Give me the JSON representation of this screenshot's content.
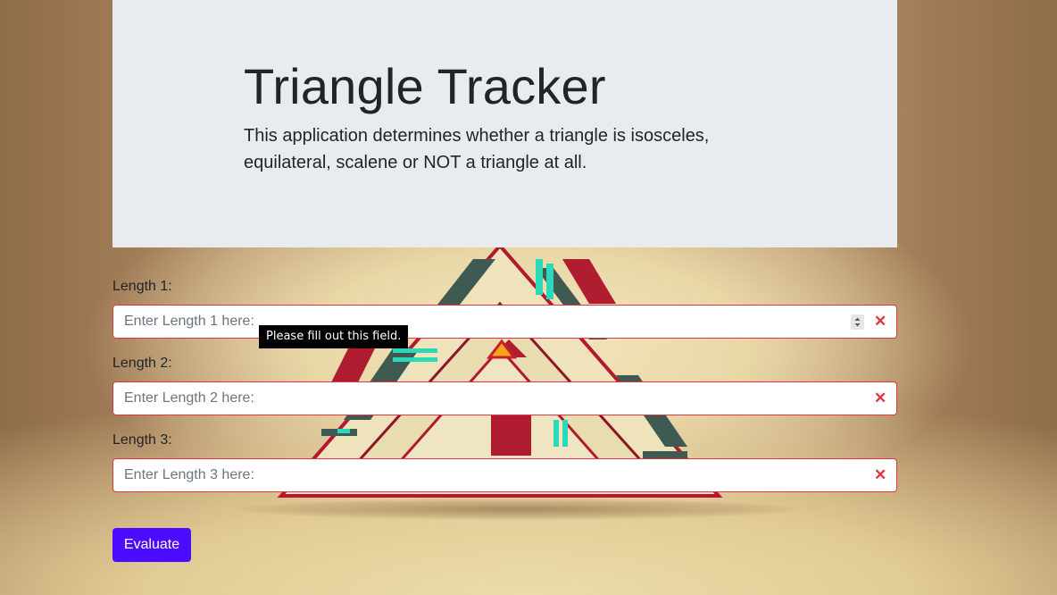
{
  "header": {
    "title": "Triangle Tracker",
    "lead": "This application determines whether a triangle is isosceles, equilateral, scalene or NOT a triangle at all."
  },
  "form": {
    "fields": [
      {
        "label": "Length 1:",
        "placeholder": "Enter Length 1 here:",
        "value": ""
      },
      {
        "label": "Length 2:",
        "placeholder": "Enter Length 2 here:",
        "value": ""
      },
      {
        "label": "Length 3:",
        "placeholder": "Enter Length 3 here:",
        "value": ""
      }
    ],
    "validation_tooltip": "Please fill out this field.",
    "submit_label": "Evaluate"
  },
  "icons": {
    "invalid": "close-icon",
    "stepper": "stepper-icon"
  },
  "colors": {
    "jumbotron_bg": "#e9ecef",
    "invalid_border": "#dc3545",
    "button_bg": "#4c0cff"
  }
}
